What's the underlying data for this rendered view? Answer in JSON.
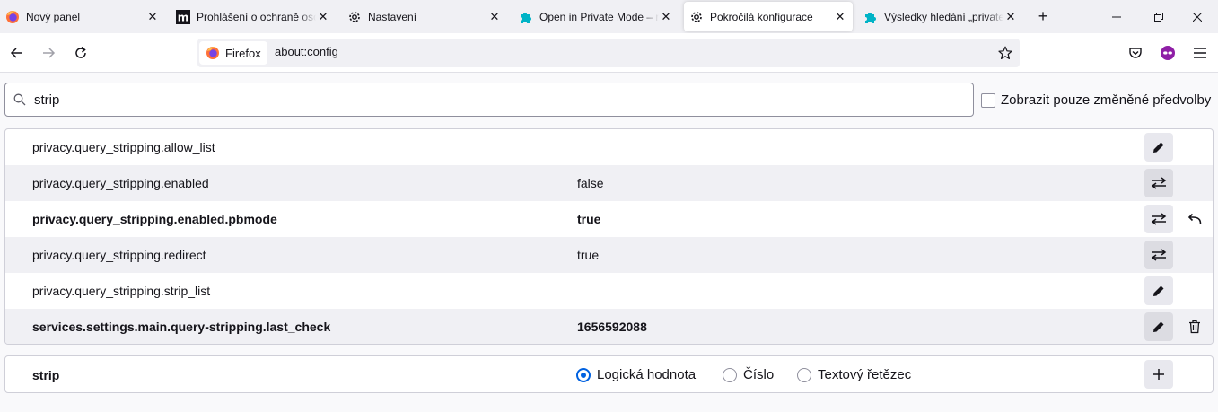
{
  "tabs": [
    {
      "title": "Nový panel",
      "icon": "firefox-icon"
    },
    {
      "title": "Prohlášení o ochraně osobních údajů",
      "icon": "m-logo-icon"
    },
    {
      "title": "Nastavení",
      "icon": "gear-icon"
    },
    {
      "title": "Open in Private Mode – reddit",
      "icon": "puzzle-icon"
    },
    {
      "title": "Pokročilá konfigurace",
      "icon": "gear-icon",
      "active": true
    },
    {
      "title": "Výsledky hledání „private",
      "icon": "puzzle-icon"
    }
  ],
  "toolbar": {
    "identity_label": "Firefox",
    "url": "about:config"
  },
  "search": {
    "value": "strip"
  },
  "show_modified_label": "Zobrazit pouze změněné předvolby",
  "prefs": [
    {
      "name": "privacy.query_stripping.allow_list",
      "value": "",
      "action": "edit-icon",
      "modified": false
    },
    {
      "name": "privacy.query_stripping.enabled",
      "value": "false",
      "action": "toggle-icon",
      "modified": false
    },
    {
      "name": "privacy.query_stripping.enabled.pbmode",
      "value": "true",
      "action": "toggle-icon",
      "modified": true,
      "extra": "reset-icon"
    },
    {
      "name": "privacy.query_stripping.redirect",
      "value": "true",
      "action": "toggle-icon",
      "modified": false
    },
    {
      "name": "privacy.query_stripping.strip_list",
      "value": "",
      "action": "edit-icon",
      "modified": false
    },
    {
      "name": "services.settings.main.query-stripping.last_check",
      "value": "1656592088",
      "action": "edit-icon",
      "modified": true,
      "extra": "trash-icon"
    }
  ],
  "add_row": {
    "name": "strip",
    "types": [
      "Logická hodnota",
      "Číslo",
      "Textový řetězec"
    ],
    "selected": "Logická hodnota"
  },
  "colors": {
    "accent": "#0061e0",
    "tabstrip_bg": "#f0f0f4",
    "row_alt_bg": "#f0f0f4"
  }
}
